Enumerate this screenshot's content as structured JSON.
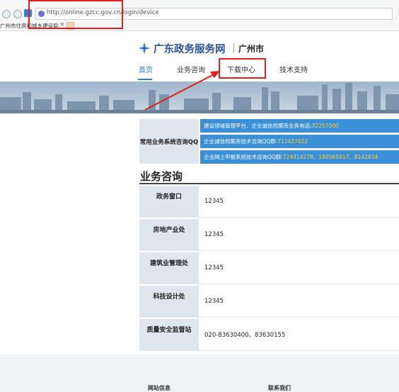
{
  "browser": {
    "url": "http://online.gzcc.gov.cn/login/device",
    "tab_title": "广州市住房和城乡建设局"
  },
  "site": {
    "title": "广东政务服务网",
    "city": "广州市"
  },
  "nav": {
    "items": [
      {
        "label": "首页",
        "active": true
      },
      {
        "label": "业务咨询",
        "active": false
      },
      {
        "label": "下载中心",
        "active": false
      },
      {
        "label": "技术支持",
        "active": false
      }
    ]
  },
  "contact": {
    "label": "常用业务系统咨询QQ",
    "rows": [
      {
        "text": "建设领域管理平台、企业诚信档案库业务电话:",
        "qq": "32257000"
      },
      {
        "text": "企业诚信档案库技术咨询QQ群:",
        "qq": "712427022"
      },
      {
        "text": "企业网上申报系统技术咨询QQ群:",
        "qq": "724414278、190565917、8142834"
      }
    ]
  },
  "consult": {
    "title": "业务咨询",
    "rows": [
      {
        "dept": "政务窗口",
        "phone": "12345"
      },
      {
        "dept": "房地产业处",
        "phone": "12345"
      },
      {
        "dept": "建筑业管理处",
        "phone": "12345"
      },
      {
        "dept": "科技设计处",
        "phone": "12345"
      },
      {
        "dept": "质量安全监督站",
        "phone": "020-83630400、83630155"
      }
    ]
  },
  "footer": {
    "site_info": "网站信息",
    "contact_us": "联系我们"
  },
  "colors": {
    "brand": "#2b5597",
    "accent": "#2e7dd1",
    "highlight": "#e02020",
    "qq": "#f3d24a"
  }
}
